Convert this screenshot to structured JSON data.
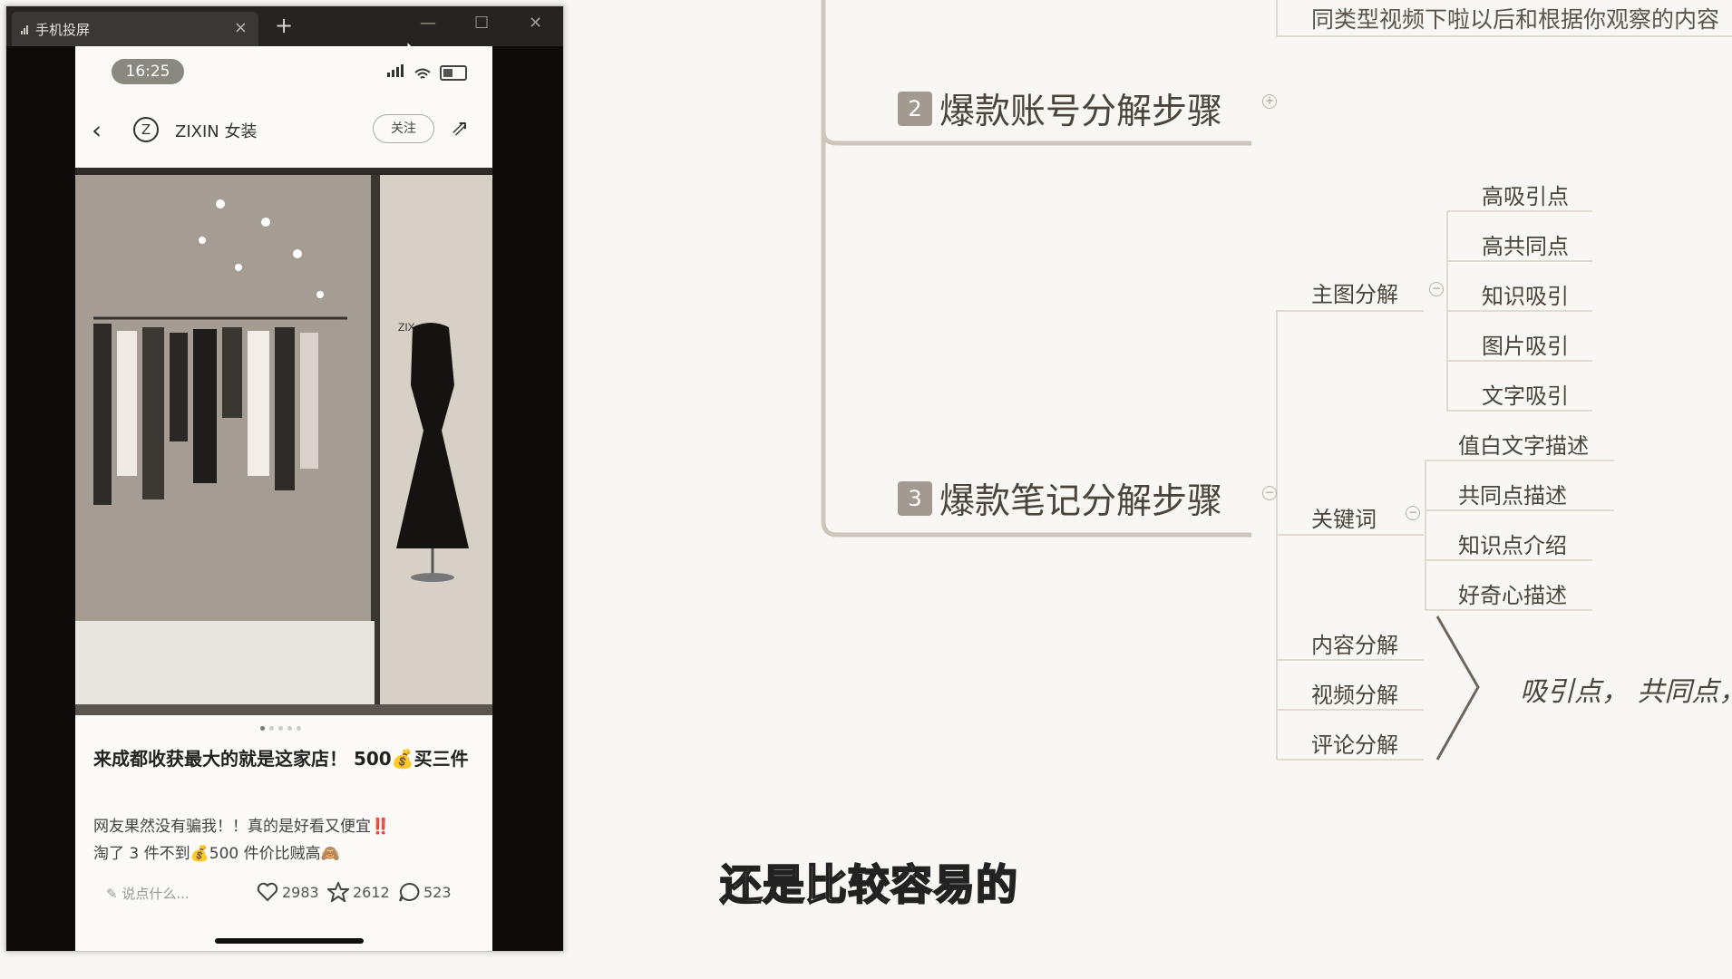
{
  "window": {
    "tab_title": "手机投屏",
    "tab_close": "×",
    "new_tab": "+",
    "min": "—",
    "max": "☐",
    "close": "✕"
  },
  "phone": {
    "time": "16:25",
    "header": {
      "back": "‹",
      "logo": "Z",
      "shop_name": "ZIXIN 女装",
      "follow": "关注",
      "share": "⇗"
    },
    "post": {
      "title": "来成都收获最大的就是这家店！ 500💰买三件",
      "body_line1": "网友果然没有骗我！！真的是好看又便宜‼️",
      "body_line2": "淘了 3 件不到💰500 件价比贼高🙈",
      "comment_placeholder": "✎ 说点什么...",
      "likes": "2983",
      "stars": "2612",
      "comments": "523"
    }
  },
  "mindmap": {
    "top_text": "同类型视频下啦以后和根据你观察的内容",
    "node2_num": "2",
    "node2_label": "爆款账号分解步骤",
    "node3_num": "3",
    "node3_label": "爆款笔记分解步骤",
    "main_image": "主图分解",
    "main_image_children": [
      "高吸引点",
      "高共同点",
      "知识吸引",
      "图片吸引",
      "文字吸引"
    ],
    "keywords": "关键词",
    "keyword_children": [
      "值白文字描述",
      "共同点描述",
      "知识点介绍",
      "好奇心描述"
    ],
    "content": "内容分解",
    "video": "视频分解",
    "comment": "评论分解",
    "side_note": "吸引点， 共同点，",
    "toggle_plus": "+",
    "toggle_minus": "−"
  },
  "subtitle": "还是比较容易的",
  "colors": {
    "line": "#c8bfb4",
    "badge": "#a29a91",
    "background": "#f9f7f3"
  }
}
